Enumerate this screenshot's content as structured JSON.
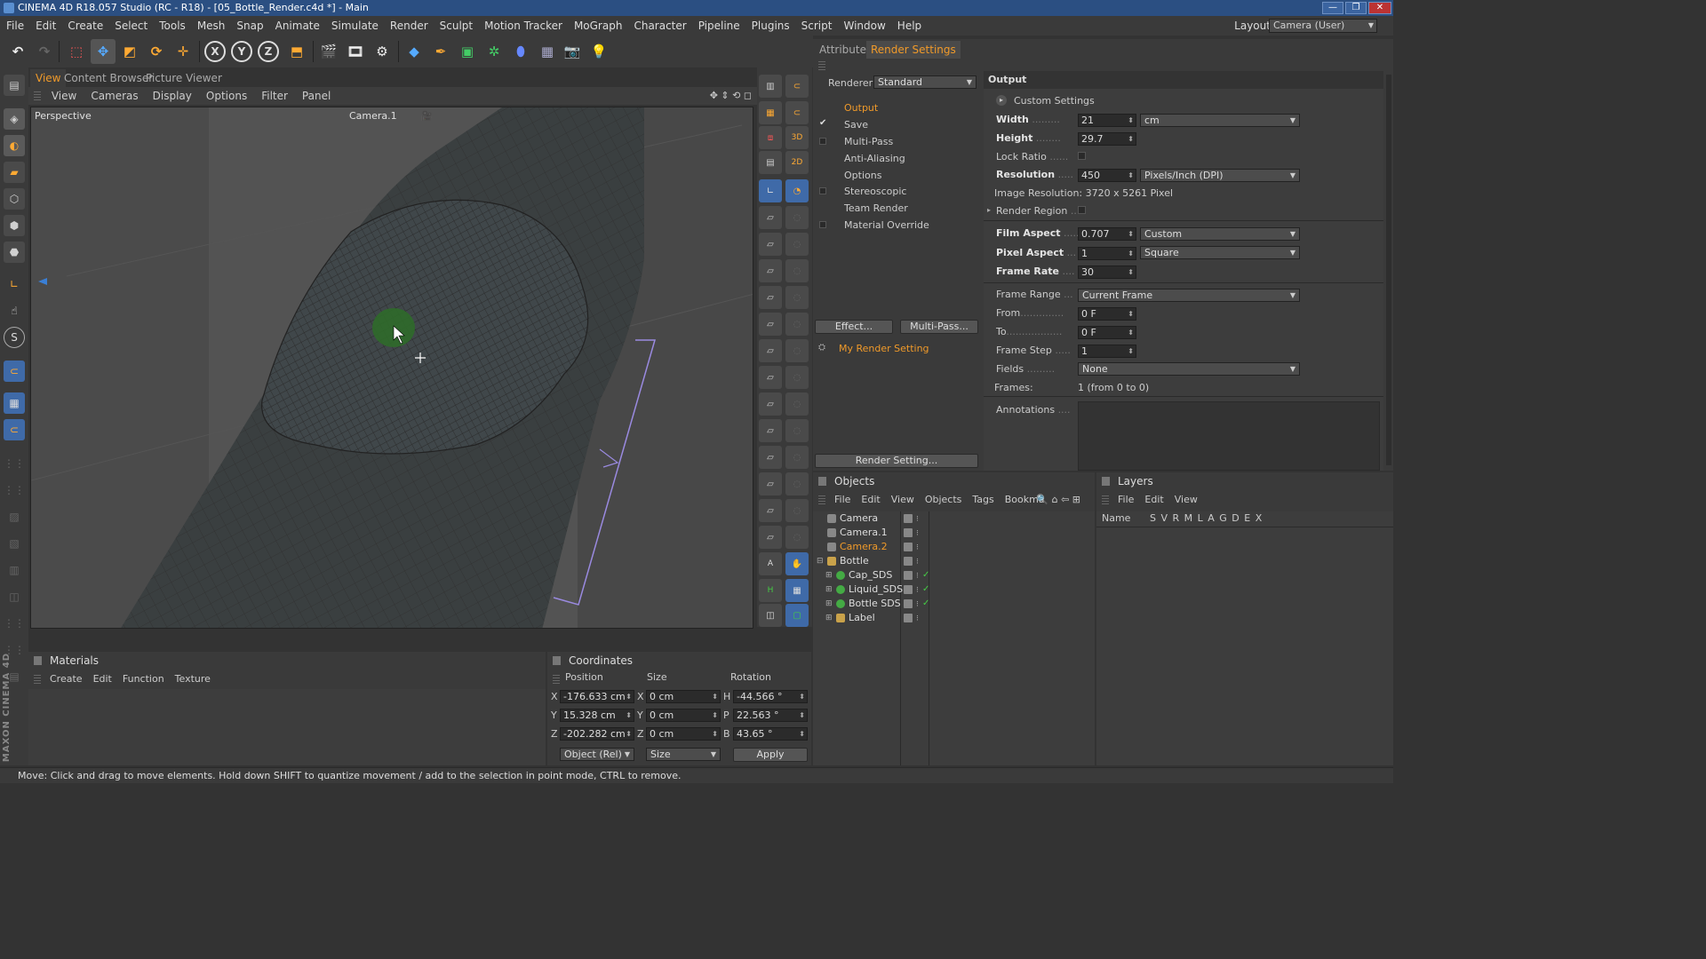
{
  "window": {
    "title": "CINEMA 4D R18.057 Studio (RC - R18) - [05_Bottle_Render.c4d *] - Main"
  },
  "menubar": {
    "items": [
      "File",
      "Edit",
      "Create",
      "Select",
      "Tools",
      "Mesh",
      "Snap",
      "Animate",
      "Simulate",
      "Render",
      "Sculpt",
      "Motion Tracker",
      "MoGraph",
      "Character",
      "Pipeline",
      "Plugins",
      "Script",
      "Window",
      "Help"
    ],
    "layout_label": "Layout:",
    "layout_value": "Camera (User)"
  },
  "view_tabs": [
    "View",
    "Content Browser",
    "Picture Viewer"
  ],
  "view_menu": [
    "View",
    "Cameras",
    "Display",
    "Options",
    "Filter",
    "Panel"
  ],
  "viewport": {
    "label": "Perspective",
    "camera": "Camera.1"
  },
  "panel_tabs": [
    "Attributes",
    "Render Settings"
  ],
  "render_settings": {
    "renderer_label": "Renderer",
    "renderer_value": "Standard",
    "items": [
      {
        "label": "Output",
        "active": true,
        "checkbox": null
      },
      {
        "label": "Save",
        "active": false,
        "checkbox": "✔"
      },
      {
        "label": "Multi-Pass",
        "active": false,
        "checkbox": ""
      },
      {
        "label": "Anti-Aliasing",
        "active": false,
        "checkbox": null
      },
      {
        "label": "Options",
        "active": false,
        "checkbox": null
      },
      {
        "label": "Stereoscopic",
        "active": false,
        "checkbox": ""
      },
      {
        "label": "Team Render",
        "active": false,
        "checkbox": null
      },
      {
        "label": "Material Override",
        "active": false,
        "checkbox": ""
      }
    ],
    "effect_button": "Effect...",
    "multipass_button": "Multi-Pass...",
    "setting_name": "My Render Setting",
    "render_setting_button": "Render Setting...",
    "output": {
      "header": "Output",
      "custom_settings": "Custom Settings",
      "width_label": "Width",
      "width_value": "21",
      "unit_value": "cm",
      "height_label": "Height",
      "height_value": "29.7",
      "lock_ratio_label": "Lock Ratio",
      "resolution_label": "Resolution",
      "resolution_value": "450",
      "resolution_unit": "Pixels/Inch (DPI)",
      "image_resolution": "Image Resolution: 3720 x 5261 Pixel",
      "render_region_label": "Render Region",
      "film_aspect_label": "Film Aspect",
      "film_aspect_value": "0.707",
      "film_aspect_preset": "Custom",
      "pixel_aspect_label": "Pixel Aspect",
      "pixel_aspect_value": "1",
      "pixel_aspect_preset": "Square",
      "frame_rate_label": "Frame Rate",
      "frame_rate_value": "30",
      "frame_range_label": "Frame Range",
      "frame_range_value": "Current Frame",
      "from_label": "From",
      "from_value": "0 F",
      "to_label": "To",
      "to_value": "0 F",
      "frame_step_label": "Frame Step",
      "frame_step_value": "1",
      "fields_label": "Fields",
      "fields_value": "None",
      "frames_label": "Frames:",
      "frames_value": "1 (from 0 to 0)",
      "annotations_label": "Annotations"
    }
  },
  "objects": {
    "title": "Objects",
    "menu": [
      "File",
      "Edit",
      "View",
      "Objects",
      "Tags",
      "Bookma"
    ],
    "rows": [
      {
        "name": "Camera",
        "indent": 0,
        "type": "camera",
        "selected": false,
        "check": false
      },
      {
        "name": "Camera.1",
        "indent": 0,
        "type": "camera",
        "selected": false,
        "check": false
      },
      {
        "name": "Camera.2",
        "indent": 0,
        "type": "camera",
        "selected": true,
        "check": false
      },
      {
        "name": "Bottle",
        "indent": 0,
        "type": "null",
        "selected": false,
        "check": false
      },
      {
        "name": "Cap_SDS",
        "indent": 1,
        "type": "sds",
        "selected": false,
        "check": true
      },
      {
        "name": "Liquid_SDS",
        "indent": 1,
        "type": "sds",
        "selected": false,
        "check": true
      },
      {
        "name": "Bottle SDS",
        "indent": 1,
        "type": "sds",
        "selected": false,
        "check": true
      },
      {
        "name": "Label",
        "indent": 1,
        "type": "null",
        "selected": false,
        "check": false
      }
    ]
  },
  "layers": {
    "title": "Layers",
    "menu": [
      "File",
      "Edit",
      "View"
    ],
    "header_name": "Name",
    "header_cols": "S V R M L A G D E X"
  },
  "materials": {
    "title": "Materials",
    "menu": [
      "Create",
      "Edit",
      "Function",
      "Texture"
    ]
  },
  "coordinates": {
    "title": "Coordinates",
    "col_position": "Position",
    "col_size": "Size",
    "col_rotation": "Rotation",
    "rows": [
      {
        "axis": "X",
        "pos": "-176.633 cm",
        "saxis": "X",
        "size": "0 cm",
        "raxis": "H",
        "rot": "-44.566 °"
      },
      {
        "axis": "Y",
        "pos": "15.328 cm",
        "saxis": "Y",
        "size": "0 cm",
        "raxis": "P",
        "rot": "22.563 °"
      },
      {
        "axis": "Z",
        "pos": "-202.282 cm",
        "saxis": "Z",
        "size": "0 cm",
        "raxis": "B",
        "rot": "43.65 °"
      }
    ],
    "mode_value": "Object (Rel)",
    "size_mode_value": "Size",
    "apply_button": "Apply"
  },
  "status": "Move: Click and drag to move elements. Hold down SHIFT to quantize movement / add to the selection in point mode, CTRL to remove.",
  "brand": "MAXON CINEMA 4D",
  "colors": {
    "accent": "#f09a2a",
    "titlebar": "#2b4f82",
    "panel": "#3a3a3a"
  }
}
